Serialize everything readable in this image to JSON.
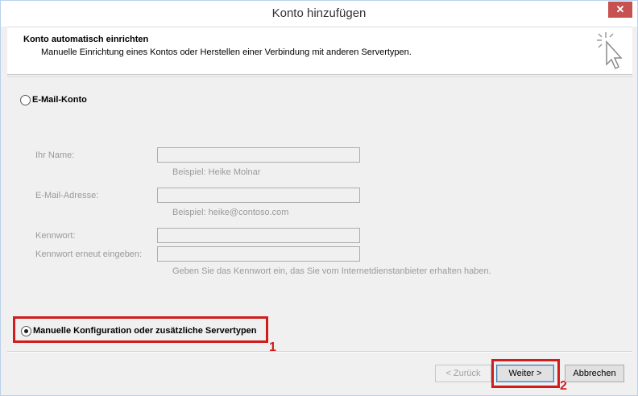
{
  "window": {
    "title": "Konto hinzufügen",
    "close_label": "✕"
  },
  "header": {
    "title": "Konto automatisch einrichten",
    "subtitle": "Manuelle Einrichtung eines Kontos oder Herstellen einer Verbindung mit anderen Servertypen.",
    "icon": "cursor-sparkle-icon"
  },
  "options": {
    "email_account": {
      "label": "E-Mail-Konto",
      "selected": false
    },
    "manual": {
      "label": "Manuelle Konfiguration oder zusätzliche Servertypen",
      "selected": true
    }
  },
  "form": {
    "name": {
      "label": "Ihr Name:",
      "value": "",
      "hint": "Beispiel: Heike Molnar"
    },
    "email": {
      "label": "E-Mail-Adresse:",
      "value": "",
      "hint": "Beispiel: heike@contoso.com"
    },
    "password": {
      "label": "Kennwort:",
      "value": ""
    },
    "password_repeat": {
      "label": "Kennwort erneut eingeben:",
      "value": ""
    },
    "password_hint": "Geben Sie das Kennwort ein, das Sie vom Internetdienstanbieter erhalten haben."
  },
  "annotations": {
    "step1": "1",
    "step2": "2",
    "color": "#d21c1c"
  },
  "buttons": {
    "back": "< Zurück",
    "next": "Weiter >",
    "cancel": "Abbrechen"
  }
}
